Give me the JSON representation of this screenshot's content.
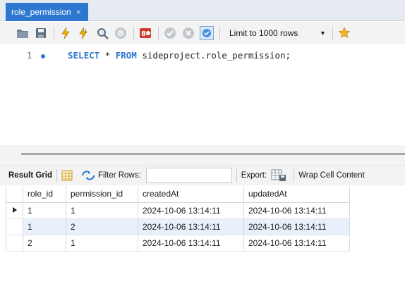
{
  "tab": {
    "title": "role_permission",
    "close": "×"
  },
  "toolbar": {
    "icons": [
      "folder-icon",
      "save-icon",
      "execute-icon",
      "execute-current-icon",
      "explain-icon",
      "stop-icon",
      "toggle-error-icon",
      "commit-icon",
      "rollback-icon",
      "autocommit-icon",
      "favorite-icon"
    ],
    "limit_label": "Limit to 1000 rows"
  },
  "editor": {
    "line_number": "1",
    "sql": {
      "select": "SELECT",
      "star": " * ",
      "from": "FROM",
      "rest": " sideproject.role_permission;"
    }
  },
  "result_toolbar": {
    "grid_label": "Result Grid",
    "filter_label": "Filter Rows:",
    "filter_value": "",
    "export_label": "Export:",
    "wrap_label": "Wrap Cell Content"
  },
  "grid": {
    "columns": [
      "role_id",
      "permission_id",
      "createdAt",
      "updatedAt"
    ],
    "rows": [
      [
        "1",
        "1",
        "2024-10-06 13:14:11",
        "2024-10-06 13:14:11"
      ],
      [
        "1",
        "2",
        "2024-10-06 13:14:11",
        "2024-10-06 13:14:11"
      ],
      [
        "2",
        "1",
        "2024-10-06 13:14:11",
        "2024-10-06 13:14:11"
      ]
    ]
  },
  "colors": {
    "tab_active": "#2e77d0",
    "keyword": "#2f78cc",
    "selected_row": "#e8f0fb"
  }
}
